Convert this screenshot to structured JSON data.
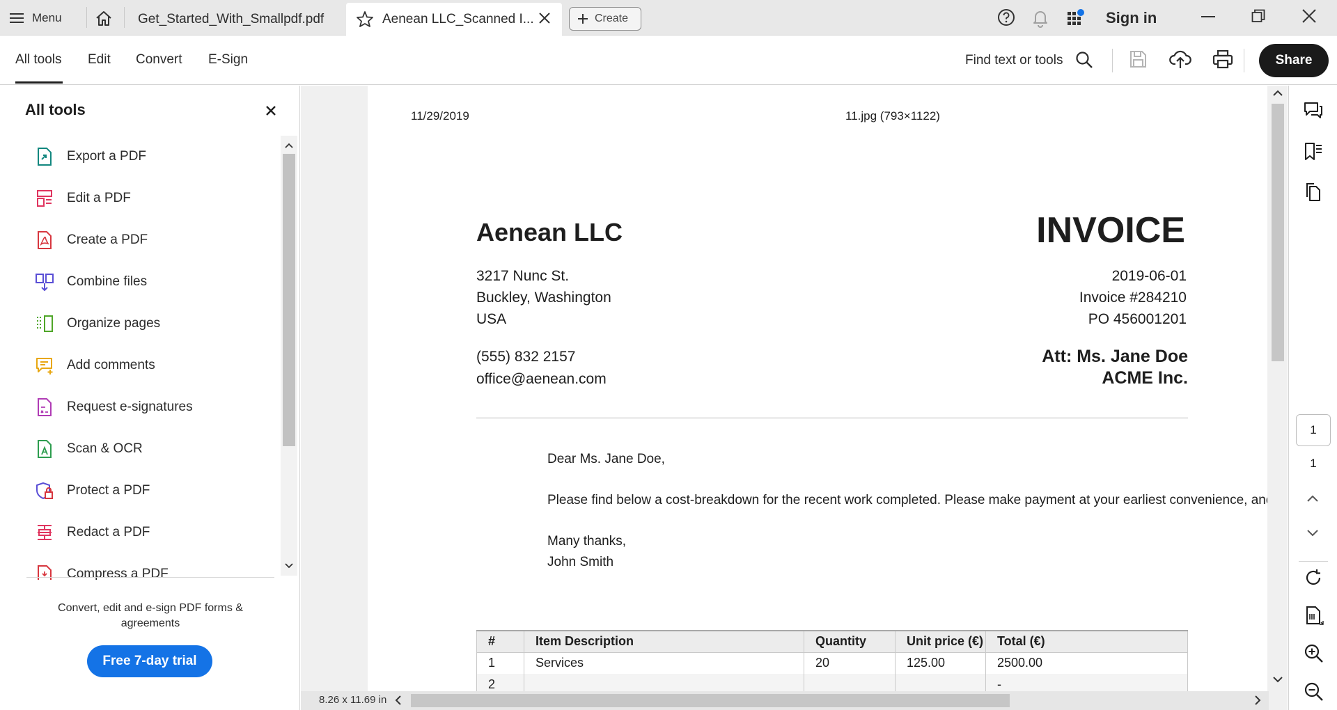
{
  "titlebar": {
    "menu_label": "Menu",
    "tabs": [
      {
        "label": "Get_Started_With_Smallpdf.pdf"
      },
      {
        "label": "Aenean LLC_Scanned I..."
      }
    ],
    "create_label": "Create",
    "signin_label": "Sign in"
  },
  "toolbar": {
    "nav": [
      "All tools",
      "Edit",
      "Convert",
      "E-Sign"
    ],
    "find_label": "Find text or tools",
    "share_label": "Share"
  },
  "tools_panel": {
    "title": "All tools",
    "items": [
      {
        "label": "Export a PDF",
        "icon": "export-pdf-icon",
        "color": "#12877f"
      },
      {
        "label": "Edit a PDF",
        "icon": "edit-pdf-icon",
        "color": "#e0355f"
      },
      {
        "label": "Create a PDF",
        "icon": "create-pdf-icon",
        "color": "#d7373f"
      },
      {
        "label": "Combine files",
        "icon": "combine-files-icon",
        "color": "#5a4fd6"
      },
      {
        "label": "Organize pages",
        "icon": "organize-pages-icon",
        "color": "#4fa628"
      },
      {
        "label": "Add comments",
        "icon": "add-comments-icon",
        "color": "#e8a712"
      },
      {
        "label": "Request e-signatures",
        "icon": "request-esignatures-icon",
        "color": "#b03bb5"
      },
      {
        "label": "Scan & OCR",
        "icon": "scan-ocr-icon",
        "color": "#2d9d4f"
      },
      {
        "label": "Protect a PDF",
        "icon": "protect-pdf-icon",
        "color": "#5a4fd6"
      },
      {
        "label": "Redact a PDF",
        "icon": "redact-pdf-icon",
        "color": "#e0355f"
      },
      {
        "label": "Compress a PDF",
        "icon": "compress-pdf-icon",
        "color": "#d7373f"
      }
    ],
    "promo_text": "Convert, edit and e-sign PDF forms & agreements",
    "trial_label": "Free 7-day trial"
  },
  "document": {
    "header_date": "11/29/2019",
    "header_file": "11.jpg (793×1122)",
    "company": "Aenean LLC",
    "title": "INVOICE",
    "address": [
      "3217 Nunc St.",
      "Buckley, Washington",
      "USA"
    ],
    "phone": "(555) 832 2157",
    "email": "office@aenean.com",
    "date": "2019-06-01",
    "invoice_no": "Invoice #284210",
    "po": "PO 456001201",
    "attention": "Att: Ms. Jane Doe",
    "client": "ACME Inc.",
    "greeting": "Dear Ms. Jane Doe,",
    "body": "Please find below a cost-breakdown for the recent work completed. Please make payment at your earliest convenience, and do not hesitate to contact me with any questions.",
    "closing": "Many thanks,",
    "signature": "John Smith",
    "table": {
      "headers": [
        "#",
        "Item Description",
        "Quantity",
        "Unit price (€)",
        "Total (€)"
      ],
      "rows": [
        [
          "1",
          "Services",
          "20",
          "125.00",
          "2500.00"
        ],
        [
          "2",
          "",
          "",
          "",
          "-"
        ]
      ]
    },
    "page_size": "8.26 x 11.69 in"
  },
  "pagination": {
    "current": "1",
    "total": "1"
  },
  "colors": {
    "accent": "#1473e6",
    "share_bg": "#1a1a1a"
  }
}
